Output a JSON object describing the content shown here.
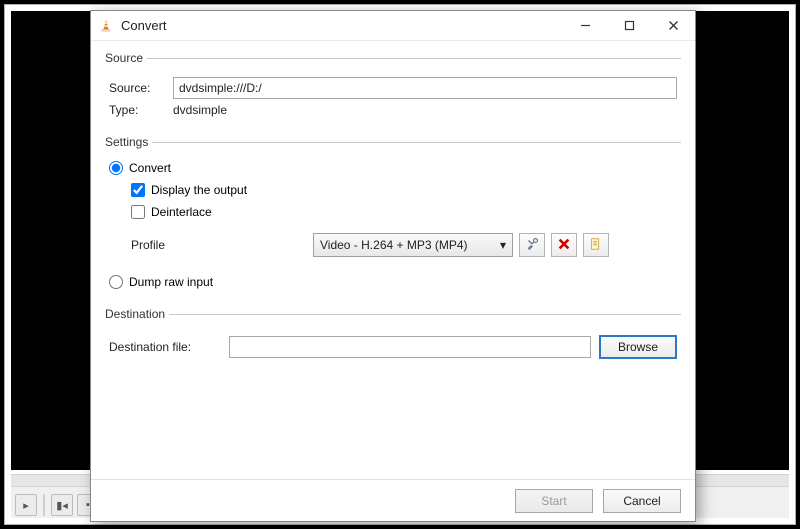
{
  "window": {
    "title": "Convert"
  },
  "source": {
    "legend": "Source",
    "source_label": "Source:",
    "source_value": "dvdsimple:///D:/",
    "type_label": "Type:",
    "type_value": "dvdsimple"
  },
  "settings": {
    "legend": "Settings",
    "convert_label": "Convert",
    "display_output_label": "Display the output",
    "deinterlace_label": "Deinterlace",
    "profile_label": "Profile",
    "profile_value": "Video - H.264 + MP3 (MP4)",
    "dump_raw_label": "Dump raw input"
  },
  "destination": {
    "legend": "Destination",
    "label": "Destination file:",
    "value": "",
    "browse_label": "Browse"
  },
  "footer": {
    "start_label": "Start",
    "cancel_label": "Cancel"
  },
  "icons": {
    "tools": "tools-icon",
    "delete": "delete-icon",
    "new": "new-profile-icon"
  }
}
